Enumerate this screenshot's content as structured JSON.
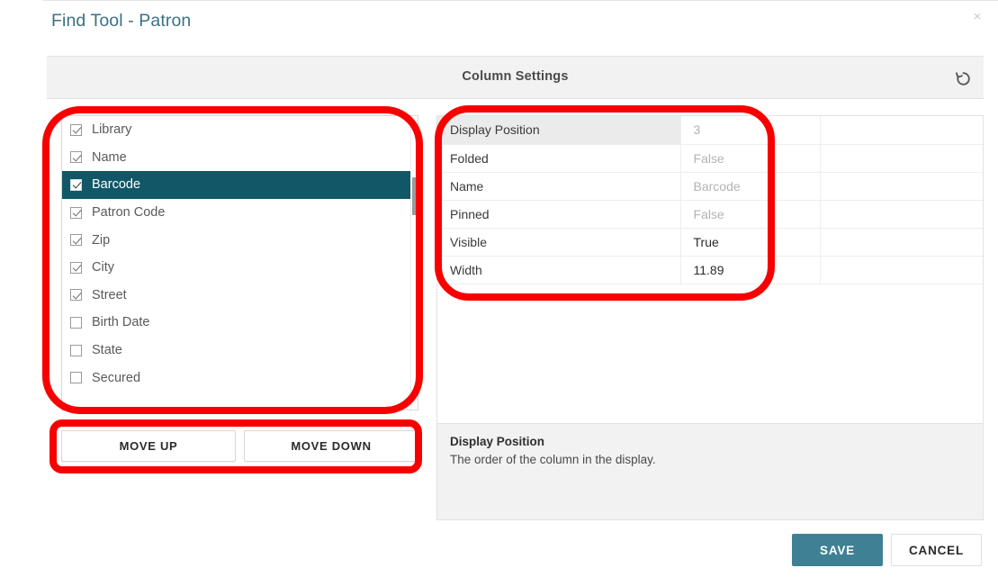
{
  "dialog": {
    "title": "Find Tool - Patron",
    "close_label": "×",
    "close_icon": "close-icon"
  },
  "section": {
    "title": "Column Settings",
    "reset_icon": "reset-counterclockwise-arrow-icon"
  },
  "column_list": {
    "items": [
      {
        "label": "Library",
        "checked": true,
        "selected": false
      },
      {
        "label": "Name",
        "checked": true,
        "selected": false
      },
      {
        "label": "Barcode",
        "checked": true,
        "selected": true
      },
      {
        "label": "Patron Code",
        "checked": true,
        "selected": false
      },
      {
        "label": "Zip",
        "checked": true,
        "selected": false
      },
      {
        "label": "City",
        "checked": true,
        "selected": false
      },
      {
        "label": "Street",
        "checked": true,
        "selected": false
      },
      {
        "label": "Birth Date",
        "checked": false,
        "selected": false
      },
      {
        "label": "State",
        "checked": false,
        "selected": false
      },
      {
        "label": "Secured",
        "checked": false,
        "selected": false
      }
    ]
  },
  "move_buttons": {
    "up_label": "MOVE UP",
    "down_label": "MOVE DOWN"
  },
  "properties": {
    "rows": [
      {
        "label": "Display Position",
        "value": "3",
        "readonly": true,
        "active": true
      },
      {
        "label": "Folded",
        "value": "False",
        "readonly": true,
        "active": false
      },
      {
        "label": "Name",
        "value": "Barcode",
        "readonly": true,
        "active": false
      },
      {
        "label": "Pinned",
        "value": "False",
        "readonly": true,
        "active": false
      },
      {
        "label": "Visible",
        "value": "True",
        "readonly": false,
        "active": false
      },
      {
        "label": "Width",
        "value": "11.89",
        "readonly": false,
        "active": false
      }
    ]
  },
  "description": {
    "title": "Display Position",
    "text": "The order of the column in the display."
  },
  "footer": {
    "save_label": "SAVE",
    "cancel_label": "CANCEL"
  },
  "colors": {
    "title_text": "#3c7183",
    "selection": "#115768",
    "save_button": "#3f8095",
    "header_bar": "#f2f2f2",
    "annotation": "#f90000"
  }
}
